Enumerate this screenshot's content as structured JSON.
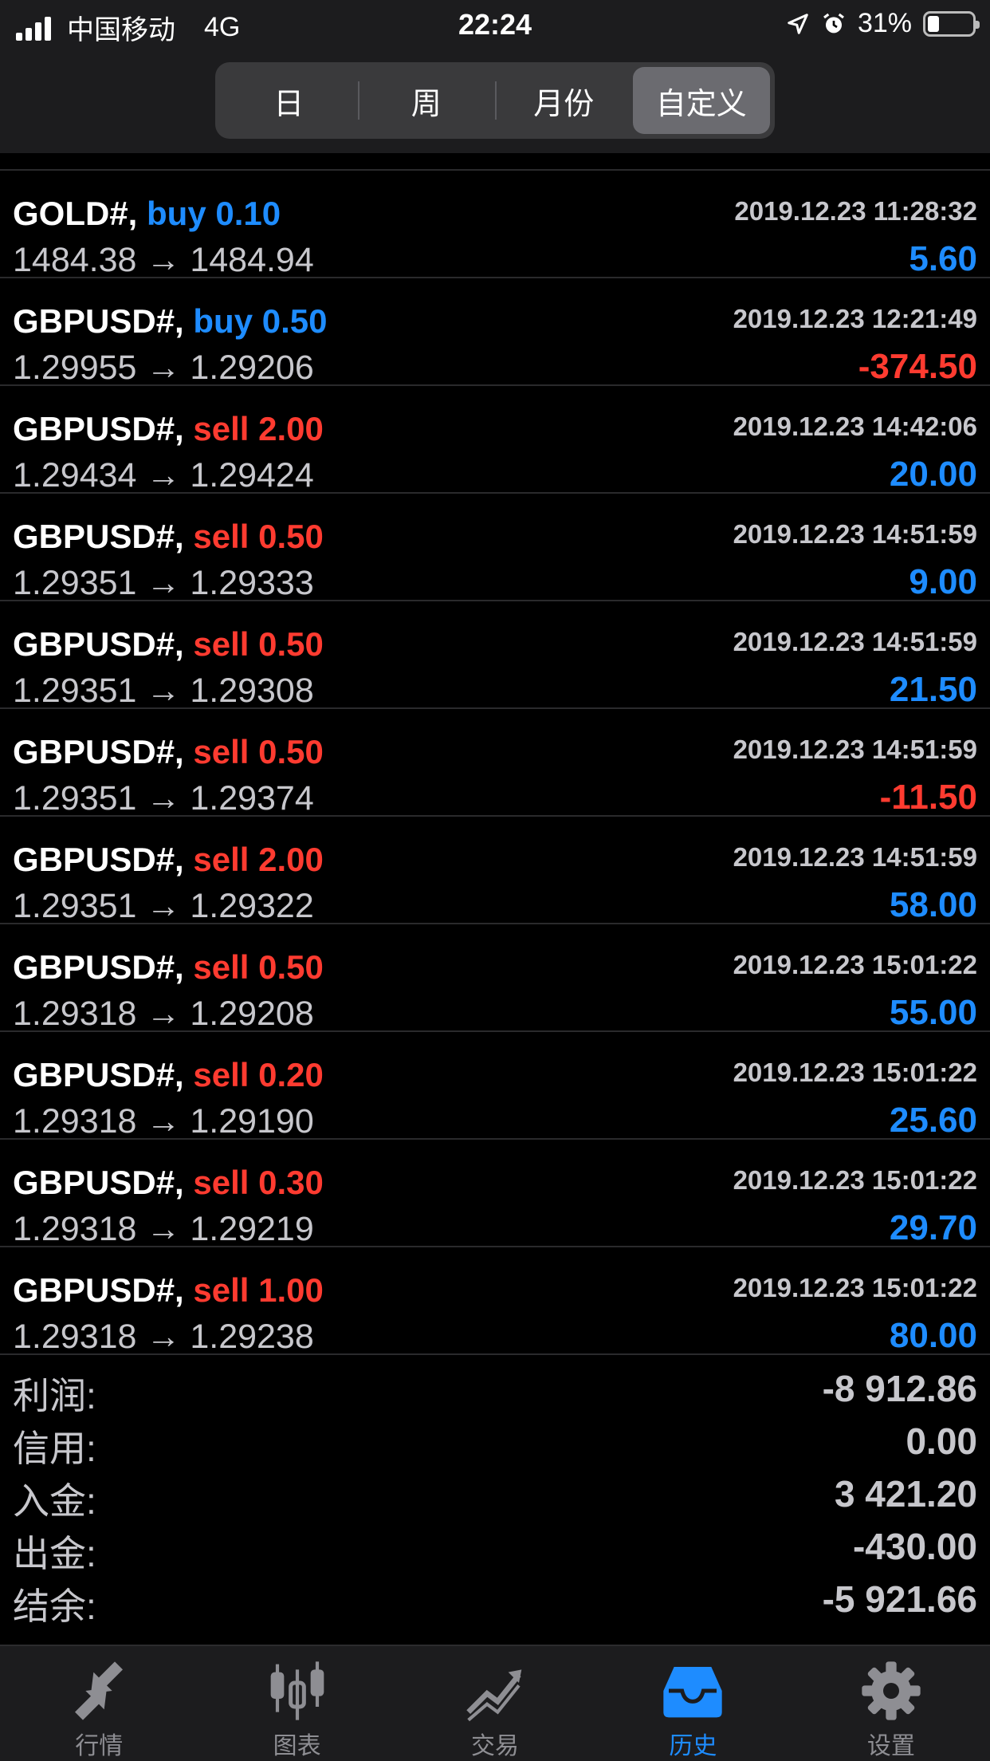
{
  "status_bar": {
    "carrier": "中国移动",
    "network": "4G",
    "time": "22:24",
    "battery": "31%"
  },
  "segments": [
    {
      "label": "日",
      "active": false
    },
    {
      "label": "周",
      "active": false
    },
    {
      "label": "月份",
      "active": false
    },
    {
      "label": "自定义",
      "active": true
    }
  ],
  "trades": [
    {
      "symbol": "GOLD#,",
      "side": "buy",
      "lots": "buy 0.10",
      "time": "2019.12.23 11:28:32",
      "prices": "1484.38 → 1484.94",
      "profit": "5.60",
      "profit_sign": "pos"
    },
    {
      "symbol": "GBPUSD#,",
      "side": "buy",
      "lots": "buy 0.50",
      "time": "2019.12.23 12:21:49",
      "prices": "1.29955 → 1.29206",
      "profit": "-374.50",
      "profit_sign": "neg"
    },
    {
      "symbol": "GBPUSD#,",
      "side": "sell",
      "lots": "sell 2.00",
      "time": "2019.12.23 14:42:06",
      "prices": "1.29434 → 1.29424",
      "profit": "20.00",
      "profit_sign": "pos"
    },
    {
      "symbol": "GBPUSD#,",
      "side": "sell",
      "lots": "sell 0.50",
      "time": "2019.12.23 14:51:59",
      "prices": "1.29351 → 1.29333",
      "profit": "9.00",
      "profit_sign": "pos"
    },
    {
      "symbol": "GBPUSD#,",
      "side": "sell",
      "lots": "sell 0.50",
      "time": "2019.12.23 14:51:59",
      "prices": "1.29351 → 1.29308",
      "profit": "21.50",
      "profit_sign": "pos"
    },
    {
      "symbol": "GBPUSD#,",
      "side": "sell",
      "lots": "sell 0.50",
      "time": "2019.12.23 14:51:59",
      "prices": "1.29351 → 1.29374",
      "profit": "-11.50",
      "profit_sign": "neg"
    },
    {
      "symbol": "GBPUSD#,",
      "side": "sell",
      "lots": "sell 2.00",
      "time": "2019.12.23 14:51:59",
      "prices": "1.29351 → 1.29322",
      "profit": "58.00",
      "profit_sign": "pos"
    },
    {
      "symbol": "GBPUSD#,",
      "side": "sell",
      "lots": "sell 0.50",
      "time": "2019.12.23 15:01:22",
      "prices": "1.29318 → 1.29208",
      "profit": "55.00",
      "profit_sign": "pos"
    },
    {
      "symbol": "GBPUSD#,",
      "side": "sell",
      "lots": "sell 0.20",
      "time": "2019.12.23 15:01:22",
      "prices": "1.29318 → 1.29190",
      "profit": "25.60",
      "profit_sign": "pos"
    },
    {
      "symbol": "GBPUSD#,",
      "side": "sell",
      "lots": "sell 0.30",
      "time": "2019.12.23 15:01:22",
      "prices": "1.29318 → 1.29219",
      "profit": "29.70",
      "profit_sign": "pos"
    },
    {
      "symbol": "GBPUSD#,",
      "side": "sell",
      "lots": "sell 1.00",
      "time": "2019.12.23 15:01:22",
      "prices": "1.29318 → 1.29238",
      "profit": "80.00",
      "profit_sign": "pos"
    }
  ],
  "summary": [
    {
      "label": "利润:",
      "value": "-8 912.86"
    },
    {
      "label": "信用:",
      "value": "0.00"
    },
    {
      "label": "入金:",
      "value": "3 421.20"
    },
    {
      "label": "出金:",
      "value": "-430.00"
    },
    {
      "label": "结余:",
      "value": "-5 921.66"
    }
  ],
  "tabs": [
    {
      "label": "行情",
      "icon": "quotes-icon",
      "active": false
    },
    {
      "label": "图表",
      "icon": "chart-icon",
      "active": false
    },
    {
      "label": "交易",
      "icon": "trade-icon",
      "active": false
    },
    {
      "label": "历史",
      "icon": "history-icon",
      "active": true
    },
    {
      "label": "设置",
      "icon": "settings-icon",
      "active": false
    }
  ],
  "colors": {
    "buy": "#1e8cff",
    "sell": "#ff3b30",
    "accent": "#1e8cff"
  }
}
